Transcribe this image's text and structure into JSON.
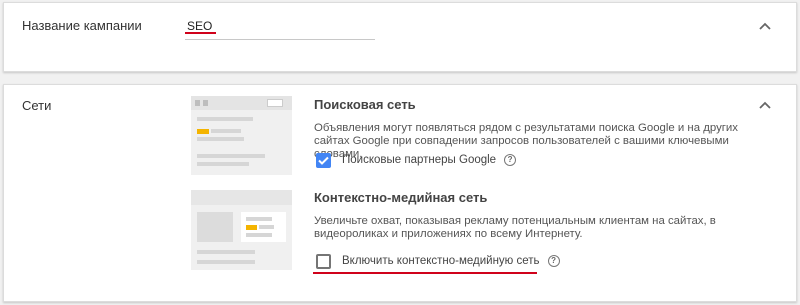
{
  "campaign": {
    "label": "Название кампании",
    "value": "SEO",
    "expanded": true
  },
  "networks": {
    "label": "Сети",
    "expanded": true,
    "search": {
      "title": "Поисковая сеть",
      "description": "Объявления могут появляться рядом с результатами поиска Google и на других сайтах Google при совпадении запросов пользователей с вашими ключевыми словами.",
      "option_label": "Поисковые партнеры Google",
      "option_checked": true,
      "help_icon": "?"
    },
    "display": {
      "title": "Контекстно-медийная сеть",
      "description": "Увеличьте охват, показывая рекламу потенциальным клиентам на сайтах, в видеороликах и приложениях по всему Интернету.",
      "option_label": "Включить контекстно-медийную сеть",
      "option_checked": false,
      "help_icon": "?"
    }
  },
  "colors": {
    "accent_blue": "#4285f4",
    "annotation_red": "#d0021b",
    "ad_yellow": "#f4b400"
  }
}
